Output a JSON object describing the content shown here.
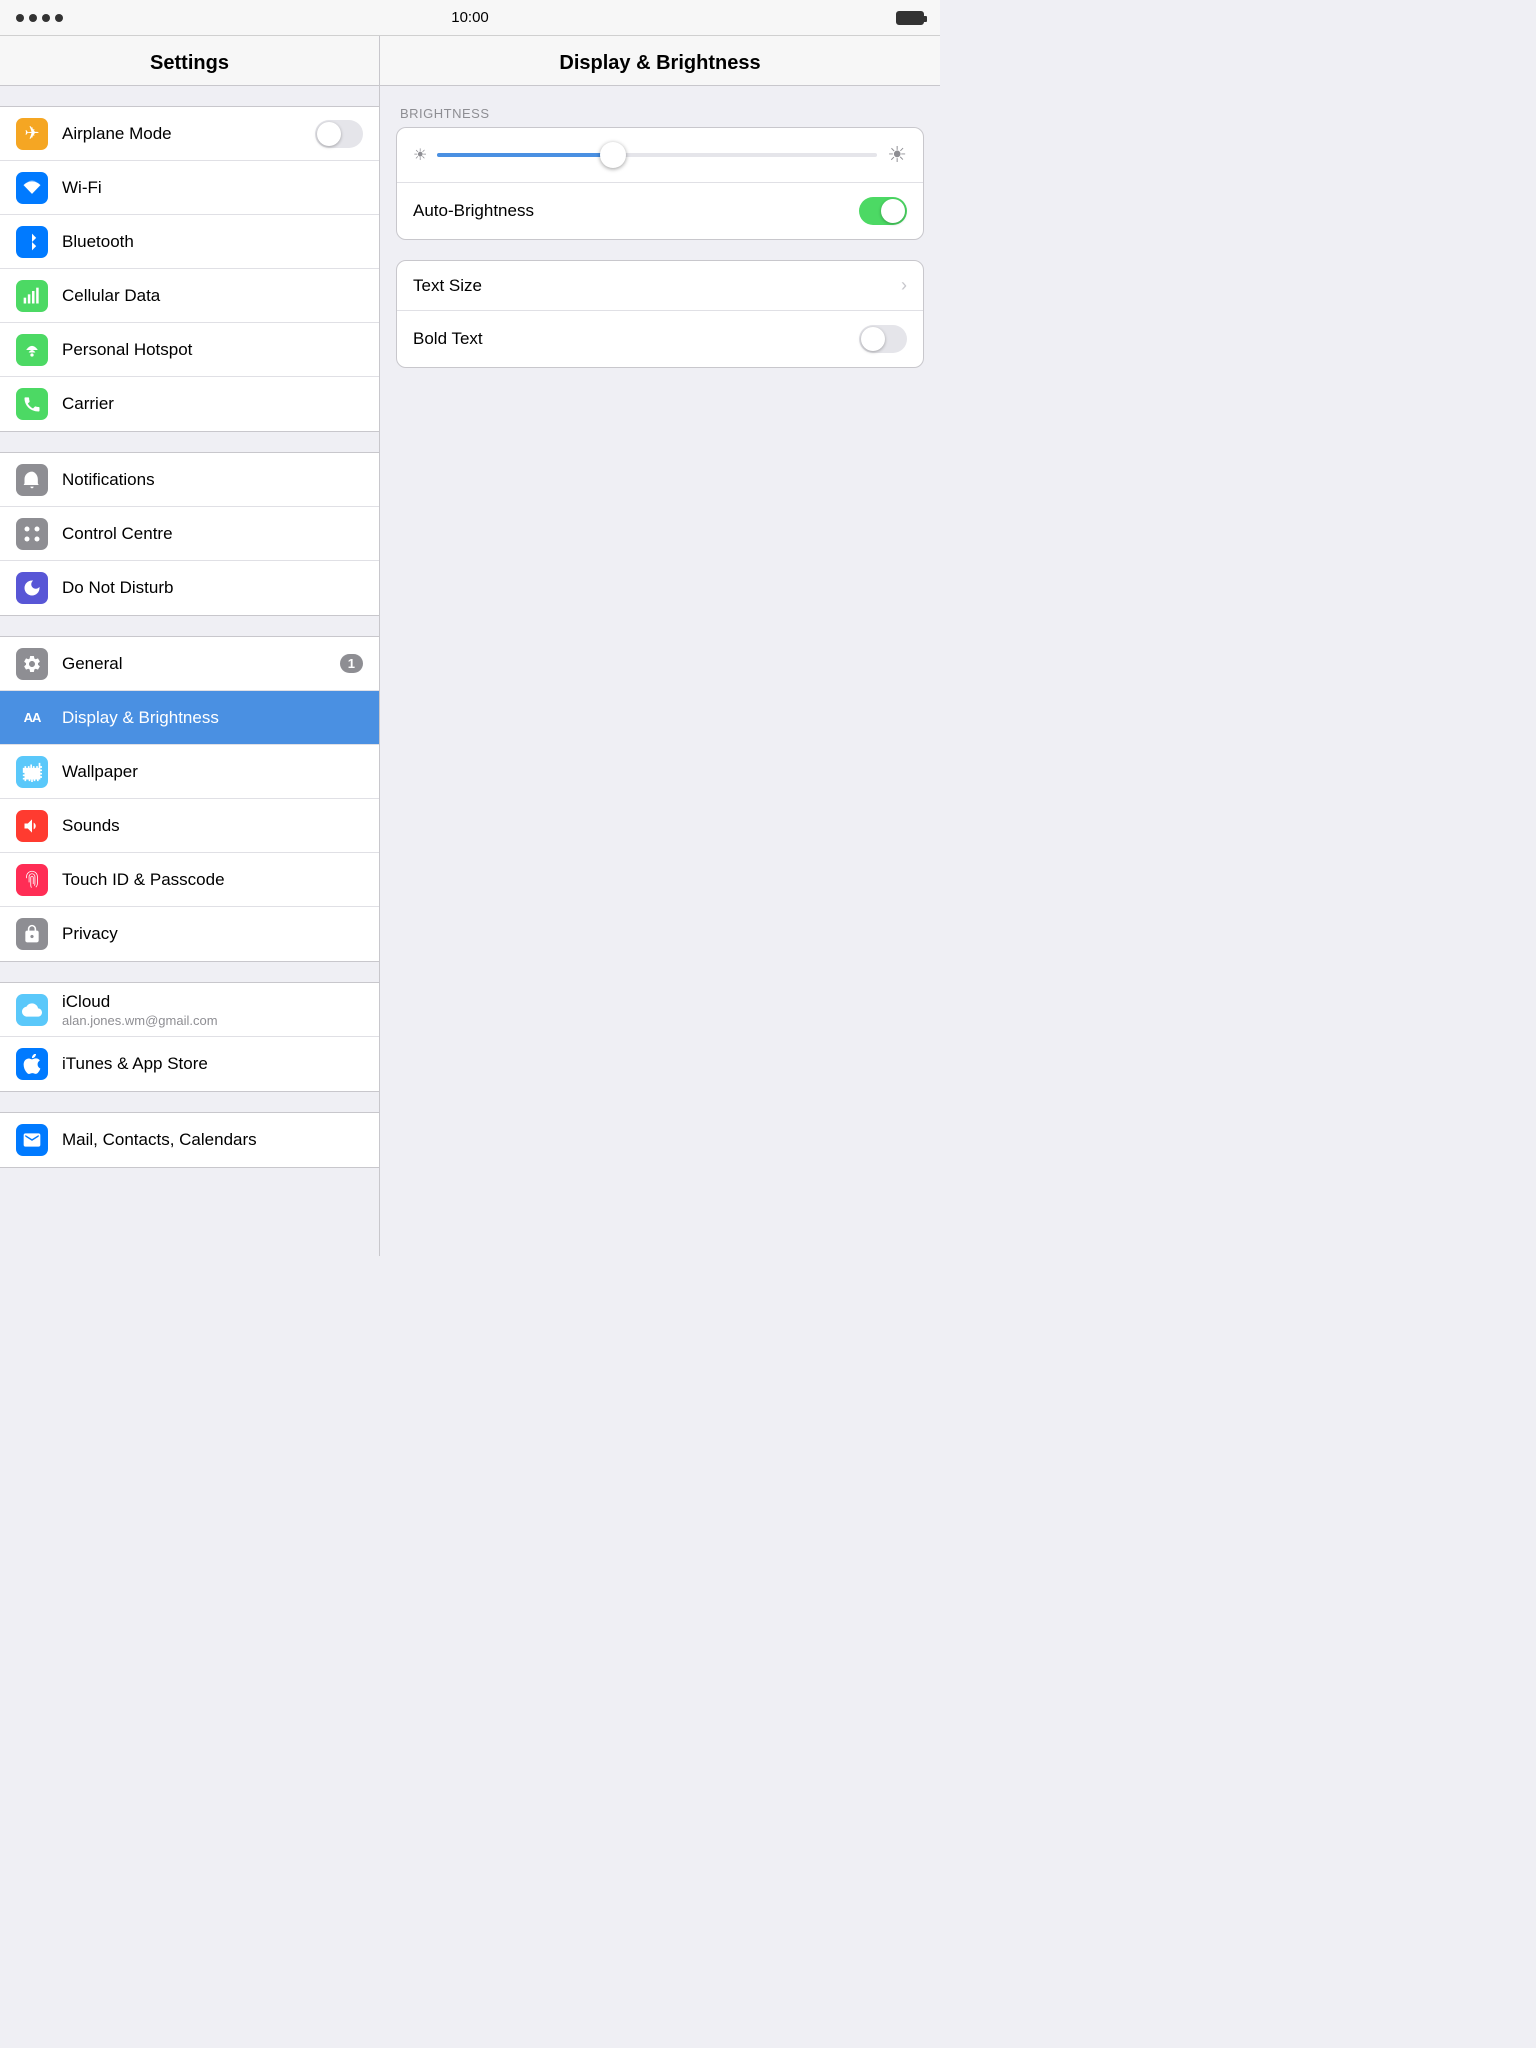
{
  "statusBar": {
    "time": "10:00",
    "dots": 4
  },
  "sidebar": {
    "title": "Settings",
    "groups": [
      {
        "id": "connectivity",
        "items": [
          {
            "id": "airplane-mode",
            "label": "Airplane Mode",
            "icon": "airplane",
            "iconClass": "icon-orange",
            "control": "toggle-off"
          },
          {
            "id": "wifi",
            "label": "Wi-Fi",
            "icon": "wifi",
            "iconClass": "icon-blue2",
            "control": "none"
          },
          {
            "id": "bluetooth",
            "label": "Bluetooth",
            "icon": "bluetooth",
            "iconClass": "icon-blue2",
            "control": "none"
          },
          {
            "id": "cellular-data",
            "label": "Cellular Data",
            "icon": "cellular",
            "iconClass": "icon-green",
            "control": "none"
          },
          {
            "id": "personal-hotspot",
            "label": "Personal Hotspot",
            "icon": "hotspot",
            "iconClass": "icon-green",
            "control": "none"
          },
          {
            "id": "carrier",
            "label": "Carrier",
            "icon": "carrier",
            "iconClass": "icon-green",
            "control": "none"
          }
        ]
      },
      {
        "id": "system",
        "items": [
          {
            "id": "notifications",
            "label": "Notifications",
            "icon": "notifications",
            "iconClass": "icon-gray",
            "control": "none"
          },
          {
            "id": "control-centre",
            "label": "Control Centre",
            "icon": "control",
            "iconClass": "icon-gray",
            "control": "none"
          },
          {
            "id": "do-not-disturb",
            "label": "Do Not Disturb",
            "icon": "moon",
            "iconClass": "icon-purple",
            "control": "none"
          }
        ]
      },
      {
        "id": "display",
        "items": [
          {
            "id": "general",
            "label": "General",
            "icon": "gear",
            "iconClass": "icon-gray",
            "control": "badge",
            "badge": "1"
          },
          {
            "id": "display-brightness",
            "label": "Display & Brightness",
            "icon": "aa",
            "iconClass": "icon-aa",
            "control": "none",
            "active": true
          },
          {
            "id": "wallpaper",
            "label": "Wallpaper",
            "icon": "wallpaper",
            "iconClass": "icon-snowflake",
            "control": "none"
          },
          {
            "id": "sounds",
            "label": "Sounds",
            "icon": "sounds",
            "iconClass": "icon-red",
            "control": "none"
          },
          {
            "id": "touch-id",
            "label": "Touch ID & Passcode",
            "icon": "fingerprint",
            "iconClass": "icon-pink",
            "control": "none"
          },
          {
            "id": "privacy",
            "label": "Privacy",
            "icon": "hand",
            "iconClass": "icon-gray",
            "control": "none"
          }
        ]
      },
      {
        "id": "accounts",
        "items": [
          {
            "id": "icloud",
            "label": "iCloud",
            "sublabel": "alan.jones.wm@gmail.com",
            "icon": "cloud",
            "iconClass": "icon-lightblue",
            "control": "none"
          },
          {
            "id": "itunes-appstore",
            "label": "iTunes & App Store",
            "icon": "appstore",
            "iconClass": "icon-blue2",
            "control": "none"
          }
        ]
      },
      {
        "id": "apps",
        "items": [
          {
            "id": "mail-contacts",
            "label": "Mail, Contacts, Calendars",
            "icon": "mail",
            "iconClass": "icon-blue2",
            "control": "none"
          }
        ]
      }
    ]
  },
  "rightPanel": {
    "title": "Display & Brightness",
    "sections": [
      {
        "label": "BRIGHTNESS",
        "items": [
          {
            "id": "brightness-slider",
            "type": "slider",
            "value": 40
          },
          {
            "id": "auto-brightness",
            "label": "Auto-Brightness",
            "type": "toggle",
            "value": true
          }
        ]
      },
      {
        "label": "",
        "items": [
          {
            "id": "text-size",
            "label": "Text Size",
            "type": "chevron"
          },
          {
            "id": "bold-text",
            "label": "Bold Text",
            "type": "toggle",
            "value": false
          }
        ]
      }
    ]
  },
  "icons": {
    "airplane": "✈",
    "wifi": "📶",
    "bluetooth": "⚡",
    "cellular": "📡",
    "hotspot": "🔗",
    "carrier": "📞",
    "notifications": "🔔",
    "control": "⚙",
    "moon": "🌙",
    "gear": "⚙",
    "aa": "AA",
    "wallpaper": "❄",
    "sounds": "🔊",
    "fingerprint": "👆",
    "hand": "✋",
    "cloud": "☁",
    "appstore": "A",
    "mail": "✉"
  }
}
